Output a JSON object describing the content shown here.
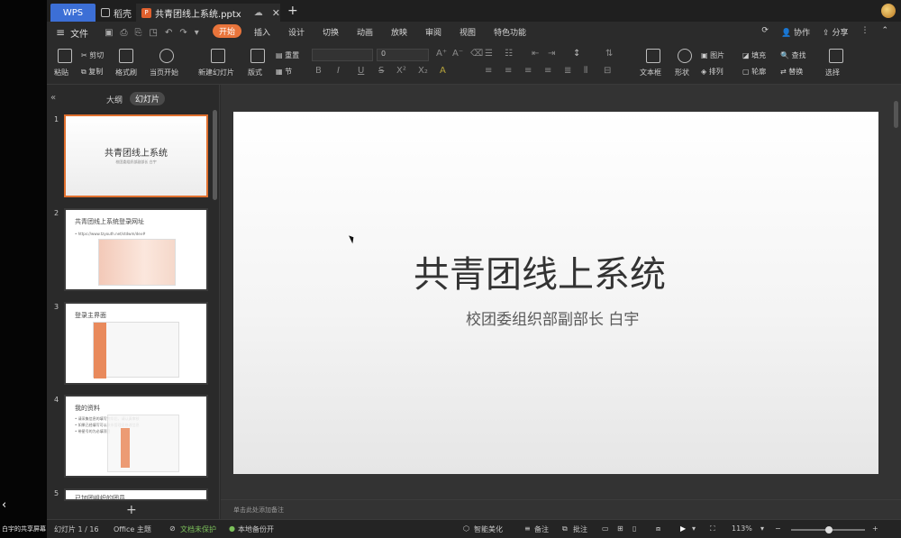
{
  "host": {
    "share_label": "白宇的共享屏幕",
    "chevron": "‹"
  },
  "titlebar": {
    "tabs": [
      {
        "label": "WPS"
      },
      {
        "label": "稻壳"
      },
      {
        "label": "共青团线上系统.pptx"
      }
    ],
    "add_tab": "+",
    "close_tab": "✕"
  },
  "menu": {
    "file_label": "文件",
    "tabs": [
      "开始",
      "插入",
      "设计",
      "切换",
      "动画",
      "放映",
      "审阅",
      "视图",
      "特色功能"
    ],
    "active_tab": "开始",
    "right": [
      "协作",
      "分享"
    ]
  },
  "ribbon": {
    "paste": "粘贴",
    "cut": "剪切",
    "copy": "复制",
    "format_painter": "格式刷",
    "start_from_current": "当页开始",
    "new_slide": "新建幻灯片",
    "layout": "版式",
    "section": "节",
    "reset": "重置",
    "font_size": "0",
    "text_box": "文本框",
    "shape": "形状",
    "picture": "图片",
    "fill": "填充",
    "arrange": "排列",
    "outline": "轮廓",
    "find": "查找",
    "replace": "替换",
    "select": "选择",
    "format_buttons": [
      "B",
      "I",
      "U",
      "S",
      "X²",
      "X₂",
      "A"
    ]
  },
  "panel": {
    "outline_tab": "大纲",
    "slides_tab": "幻灯片",
    "thumbnails": [
      {
        "number": "1",
        "title": "共青团线上系统",
        "subtitle": "校团委组织部副部长 白宇"
      },
      {
        "number": "2",
        "title": "共青团线上系统登录网址",
        "bullet": "• https://www.tzyouth.net/stdwm/dev#"
      },
      {
        "number": "3",
        "title": "登录主界面"
      },
      {
        "number": "4",
        "title": "我的资料",
        "bullets": [
          "• 请采集信息的填写完毕后，请认真审核",
          "• 如果已经填写可以联系管理员修改信息",
          "• 带星号的为必填项目"
        ]
      },
      {
        "number": "5",
        "title": "已加团组织的团员"
      }
    ],
    "add_button": "+"
  },
  "slide": {
    "title": "共青团线上系统",
    "subtitle": "校团委组织部副部长 白宇"
  },
  "notes_placeholder": "单击此处添加备注",
  "status": {
    "slide_counter": "幻灯片 1 / 16",
    "theme": "Office 主题",
    "doc_protect": "文档未保护",
    "backup": "本地备份开",
    "beautify": "智能美化",
    "notes": "备注",
    "comments": "批注",
    "zoom": "113%",
    "zoom_fraction": 0.52
  },
  "colors": {
    "accent": "#e8743b",
    "wps_blue": "#3c6fd6",
    "panel_bg": "#2a2a2a"
  }
}
